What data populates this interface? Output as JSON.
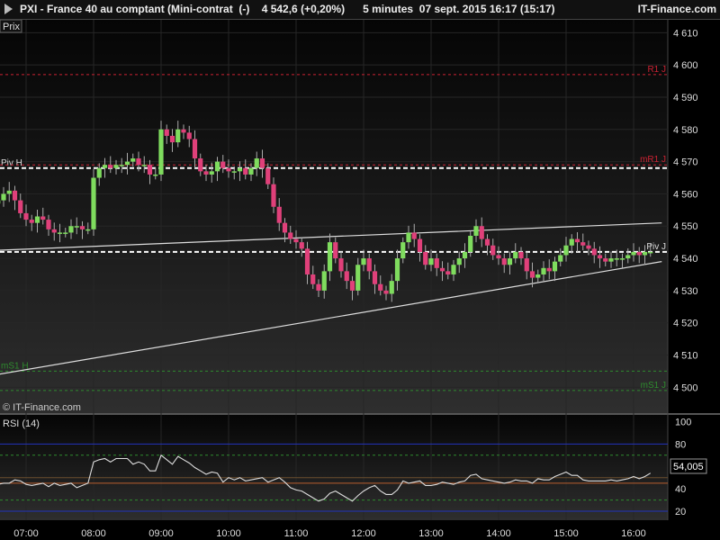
{
  "header": {
    "title": "PXI - France 40 au comptant (Mini-contrat  (-)    4 542,6 (+0,20%)      5 minutes  07 sept. 2015 16:17 (15:17)",
    "brand": "IT-Finance.com"
  },
  "main_panel": {
    "label": "Prix",
    "watermark": "© IT-Finance.com"
  },
  "rsi_panel": {
    "label": "RSI (14)",
    "current_value": "54,005"
  },
  "colors": {
    "up": "#7fdc5e",
    "down": "#e0407a",
    "resistance": "#cc2233",
    "support": "#2e8b2e",
    "pivot": "#ffffff",
    "trend": "#dddddd",
    "rsi_line": "#dddddd",
    "rsi_band": "#2233bb"
  },
  "chart_data": [
    {
      "type": "candlestick",
      "title": "PXI - France 40 au comptant (Mini-contrat  (-)",
      "interval": "5 minutes",
      "last": "4 542,6 (+0,20%)",
      "date": "07 sept. 2015 16:17 (15:17)",
      "x_ticks": [
        "07:00",
        "08:00",
        "09:00",
        "10:00",
        "11:00",
        "12:00",
        "13:00",
        "14:00",
        "15:00",
        "16:00"
      ],
      "y_ticks": [
        4500,
        4510,
        4520,
        4530,
        4540,
        4550,
        4560,
        4570,
        4580,
        4590,
        4600,
        4610
      ],
      "y_tick_labels": [
        "4 500",
        "4 510",
        "4 520",
        "4 530",
        "4 540",
        "4 550",
        "4 560",
        "4 570",
        "4 580",
        "4 590",
        "4 600",
        "4 610"
      ],
      "ylim": [
        4492,
        4614
      ],
      "close_series": [
        4558,
        4560,
        4561,
        4558,
        4554,
        4552,
        4551,
        4553,
        4552,
        4549,
        4548,
        4548,
        4548,
        4550,
        4550,
        4549,
        4549,
        4565,
        4568,
        4569,
        4568,
        4569,
        4569,
        4570,
        4571,
        4569,
        4569,
        4566,
        4566,
        4580,
        4578,
        4576,
        4580,
        4579,
        4577,
        4571,
        4567,
        4566,
        4567,
        4570,
        4568,
        4567,
        4567,
        4568,
        4566,
        4568,
        4571,
        4568,
        4563,
        4556,
        4551,
        4548,
        4546,
        4545,
        4543,
        4535,
        4532,
        4530,
        4536,
        4545,
        4540,
        4536,
        4533,
        4530,
        4538,
        4540,
        4536,
        4532,
        4530,
        4529,
        4533,
        4540,
        4545,
        4548,
        4546,
        4542,
        4538,
        4540,
        4537,
        4536,
        4535,
        4538,
        4540,
        4542,
        4547,
        4550,
        4546,
        4544,
        4541,
        4540,
        4538,
        4540,
        4542,
        4540,
        4536,
        4534,
        4535,
        4537,
        4536,
        4539,
        4541,
        4544,
        4546,
        4545,
        4544,
        4543,
        4541,
        4540,
        4539,
        4540,
        4540,
        4540,
        4541,
        4542,
        4541,
        4542,
        4542
      ],
      "series": [
        {
          "name": "Piv H",
          "type": "level",
          "value": 4568
        },
        {
          "name": "Piv J",
          "type": "level",
          "value": 4542
        },
        {
          "name": "R1 J",
          "type": "level",
          "value": 4597
        },
        {
          "name": "mR1 J",
          "type": "level",
          "value": 4569
        },
        {
          "name": "mS1 H",
          "type": "level",
          "value": 4505
        },
        {
          "name": "mS1 J",
          "type": "level",
          "value": 4499
        },
        {
          "type": "trendline",
          "points": [
            [
              "06:35",
              4542.5
            ],
            [
              "16:25",
              4551
            ]
          ]
        },
        {
          "type": "trendline",
          "points": [
            [
              "06:35",
              4504
            ],
            [
              "16:25",
              4539
            ]
          ]
        }
      ]
    },
    {
      "type": "line",
      "title": "RSI (14)",
      "y_ticks": [
        20,
        40,
        60,
        80,
        100
      ],
      "ylim": [
        12,
        106
      ],
      "levels": [
        20,
        30,
        45,
        50,
        70,
        80
      ],
      "values": [
        44,
        45,
        45,
        48,
        47,
        44,
        43,
        44,
        45,
        42,
        45,
        43,
        44,
        45,
        41,
        43,
        45,
        64,
        66,
        67,
        64,
        67,
        67,
        67,
        62,
        64,
        62,
        56,
        56,
        70,
        66,
        62,
        69,
        66,
        63,
        59,
        56,
        53,
        55,
        54,
        46,
        50,
        48,
        50,
        47,
        48,
        49,
        50,
        46,
        48,
        50,
        46,
        41,
        39,
        38,
        35,
        32,
        29,
        31,
        36,
        38,
        35,
        32,
        29,
        34,
        38,
        41,
        43,
        38,
        35,
        35,
        39,
        47,
        45,
        46,
        47,
        43,
        43,
        44,
        46,
        45,
        44,
        46,
        47,
        52,
        53,
        49,
        48,
        47,
        46,
        45,
        46,
        48,
        47,
        47,
        45,
        49,
        48,
        48,
        51,
        53,
        55,
        52,
        52,
        48,
        47,
        47,
        47,
        47,
        48,
        47,
        48,
        49,
        51,
        49,
        51,
        54
      ]
    }
  ]
}
